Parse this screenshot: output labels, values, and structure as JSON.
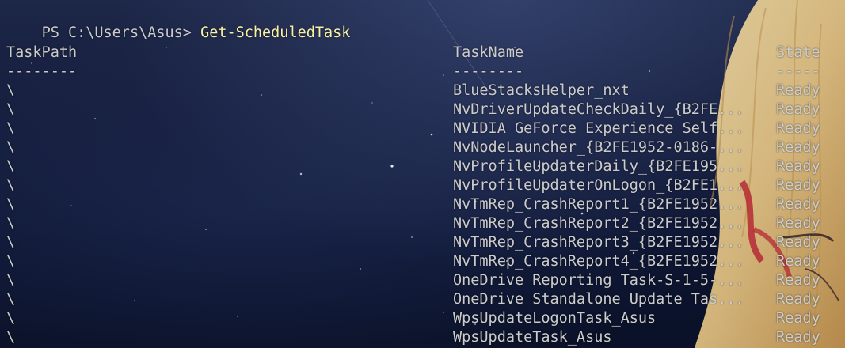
{
  "prompt": {
    "ps_prefix": "PS C:\\Users\\Asus>",
    "command": "Get-ScheduledTask"
  },
  "table": {
    "headers": [
      "TaskPath",
      "TaskName",
      "State"
    ],
    "underlines": [
      "--------",
      "--------",
      "-----"
    ],
    "rows": [
      {
        "path": "\\",
        "name": "BlueStacksHelper_nxt",
        "state": "Ready"
      },
      {
        "path": "\\",
        "name": "NvDriverUpdateCheckDaily_{B2FE...",
        "state": "Ready"
      },
      {
        "path": "\\",
        "name": "NVIDIA GeForce Experience Self...",
        "state": "Ready"
      },
      {
        "path": "\\",
        "name": "NvNodeLauncher_{B2FE1952-0186-...",
        "state": "Ready"
      },
      {
        "path": "\\",
        "name": "NvProfileUpdaterDaily_{B2FE195...",
        "state": "Ready"
      },
      {
        "path": "\\",
        "name": "NvProfileUpdaterOnLogon_{B2FE1...",
        "state": "Ready"
      },
      {
        "path": "\\",
        "name": "NvTmRep_CrashReport1_{B2FE1952...",
        "state": "Ready"
      },
      {
        "path": "\\",
        "name": "NvTmRep_CrashReport2_{B2FE1952...",
        "state": "Ready"
      },
      {
        "path": "\\",
        "name": "NvTmRep_CrashReport3_{B2FE1952...",
        "state": "Ready"
      },
      {
        "path": "\\",
        "name": "NvTmRep_CrashReport4_{B2FE1952...",
        "state": "Ready"
      },
      {
        "path": "\\",
        "name": "OneDrive Reporting Task-S-1-5-...",
        "state": "Ready"
      },
      {
        "path": "\\",
        "name": "OneDrive Standalone Update Tas...",
        "state": "Ready"
      },
      {
        "path": "\\",
        "name": "WpsUpdateLogonTask_Asus",
        "state": "Ready"
      },
      {
        "path": "\\",
        "name": "WpsUpdateTask_Asus",
        "state": "Ready"
      }
    ]
  },
  "colors": {
    "text": "#cccccc",
    "command": "#f9f1a5",
    "background": "#0c1430"
  }
}
